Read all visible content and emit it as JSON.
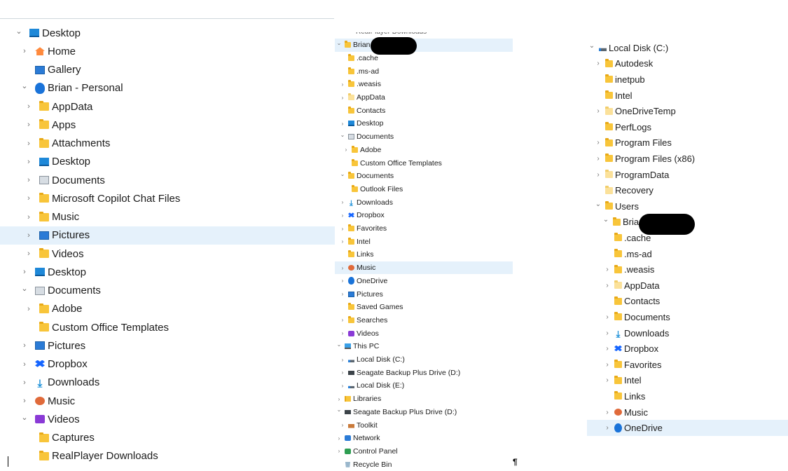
{
  "panel1": {
    "rows": [
      {
        "label": "Desktop",
        "indent": 0,
        "chev": "open",
        "icon": "monitor"
      },
      {
        "label": "Home",
        "indent": 1,
        "chev": "closed",
        "icon": "home"
      },
      {
        "label": "Gallery",
        "indent": 1,
        "chev": "none",
        "icon": "pic"
      },
      {
        "label": "Brian - Personal",
        "indent": 1,
        "chev": "open",
        "icon": "cloud"
      },
      {
        "label": "AppData",
        "indent": 2,
        "chev": "closed",
        "icon": "folder"
      },
      {
        "label": "Apps",
        "indent": 2,
        "chev": "closed",
        "icon": "folder"
      },
      {
        "label": "Attachments",
        "indent": 2,
        "chev": "closed",
        "icon": "folder"
      },
      {
        "label": "Desktop",
        "indent": 2,
        "chev": "closed",
        "icon": "monitor"
      },
      {
        "label": "Documents",
        "indent": 2,
        "chev": "closed",
        "icon": "doc"
      },
      {
        "label": "Microsoft Copilot Chat Files",
        "indent": 2,
        "chev": "closed",
        "icon": "folder"
      },
      {
        "label": "Music",
        "indent": 2,
        "chev": "closed",
        "icon": "folder"
      },
      {
        "label": "Pictures",
        "indent": 2,
        "chev": "closed",
        "icon": "pic",
        "selected": true
      },
      {
        "label": "Videos",
        "indent": 2,
        "chev": "closed",
        "icon": "folder"
      },
      {
        "label": "Desktop",
        "indent": 1,
        "chev": "closed",
        "icon": "monitor"
      },
      {
        "label": "Documents",
        "indent": 1,
        "chev": "open",
        "icon": "doc"
      },
      {
        "label": "Adobe",
        "indent": 2,
        "chev": "closed",
        "icon": "folder"
      },
      {
        "label": "Custom Office Templates",
        "indent": 2,
        "chev": "none",
        "icon": "folder"
      },
      {
        "label": "Pictures",
        "indent": 1,
        "chev": "closed",
        "icon": "pic"
      },
      {
        "label": "Dropbox",
        "indent": 1,
        "chev": "closed",
        "icon": "dropbox"
      },
      {
        "label": "Downloads",
        "indent": 1,
        "chev": "closed",
        "icon": "download"
      },
      {
        "label": "Music",
        "indent": 1,
        "chev": "closed",
        "icon": "music"
      },
      {
        "label": "Videos",
        "indent": 1,
        "chev": "open",
        "icon": "video"
      },
      {
        "label": "Captures",
        "indent": 2,
        "chev": "none",
        "icon": "folder"
      },
      {
        "label": "RealPlayer Downloads",
        "indent": 2,
        "chev": "none",
        "icon": "folder"
      }
    ]
  },
  "panel2": {
    "top_cut_label": "RealPlayer Downloads",
    "rows": [
      {
        "label": "Brian",
        "indent": 0,
        "chev": "open",
        "icon": "folder",
        "selected": true
      },
      {
        "label": ".cache",
        "indent": 1,
        "chev": "none",
        "icon": "folder"
      },
      {
        "label": ".ms-ad",
        "indent": 1,
        "chev": "none",
        "icon": "folder"
      },
      {
        "label": ".weasis",
        "indent": 1,
        "chev": "closed",
        "icon": "folder"
      },
      {
        "label": "AppData",
        "indent": 1,
        "chev": "closed",
        "icon": "folder pale"
      },
      {
        "label": "Contacts",
        "indent": 1,
        "chev": "none",
        "icon": "folder"
      },
      {
        "label": "Desktop",
        "indent": 1,
        "chev": "closed",
        "icon": "monitor"
      },
      {
        "label": "Documents",
        "indent": 1,
        "chev": "open",
        "icon": "doc"
      },
      {
        "label": "Adobe",
        "indent": 2,
        "chev": "closed",
        "icon": "folder"
      },
      {
        "label": "Custom Office Templates",
        "indent": 2,
        "chev": "none",
        "icon": "folder"
      },
      {
        "label": "Documents",
        "indent": 1,
        "chev": "open",
        "icon": "folder"
      },
      {
        "label": "Outlook Files",
        "indent": 2,
        "chev": "none",
        "icon": "folder"
      },
      {
        "label": "Downloads",
        "indent": 1,
        "chev": "closed",
        "icon": "download"
      },
      {
        "label": "Dropbox",
        "indent": 1,
        "chev": "closed",
        "icon": "dropbox"
      },
      {
        "label": "Favorites",
        "indent": 1,
        "chev": "closed",
        "icon": "folder"
      },
      {
        "label": "Intel",
        "indent": 1,
        "chev": "closed",
        "icon": "folder"
      },
      {
        "label": "Links",
        "indent": 1,
        "chev": "none",
        "icon": "folder"
      },
      {
        "label": "Music",
        "indent": 1,
        "chev": "closed",
        "icon": "music",
        "selected": true
      },
      {
        "label": "OneDrive",
        "indent": 1,
        "chev": "closed",
        "icon": "cloud"
      },
      {
        "label": "Pictures",
        "indent": 1,
        "chev": "closed",
        "icon": "pic"
      },
      {
        "label": "Saved Games",
        "indent": 1,
        "chev": "none",
        "icon": "folder"
      },
      {
        "label": "Searches",
        "indent": 1,
        "chev": "closed",
        "icon": "folder"
      },
      {
        "label": "Videos",
        "indent": 1,
        "chev": "closed",
        "icon": "video"
      },
      {
        "label": "This PC",
        "indent": 0,
        "chev": "open",
        "icon": "pc"
      },
      {
        "label": "Local Disk (C:)",
        "indent": 1,
        "chev": "closed",
        "icon": "disk"
      },
      {
        "label": "Seagate Backup Plus Drive (D:)",
        "indent": 1,
        "chev": "closed",
        "icon": "drive"
      },
      {
        "label": "Local Disk (E:)",
        "indent": 1,
        "chev": "closed",
        "icon": "disk"
      },
      {
        "label": "Libraries",
        "indent": 0,
        "chev": "closed",
        "icon": "lib"
      },
      {
        "label": "Seagate Backup Plus Drive (D:)",
        "indent": 0,
        "chev": "open",
        "icon": "drive"
      },
      {
        "label": "Toolkit",
        "indent": 1,
        "chev": "closed",
        "icon": "tool"
      },
      {
        "label": "Network",
        "indent": 0,
        "chev": "closed",
        "icon": "net"
      },
      {
        "label": "Control Panel",
        "indent": 0,
        "chev": "closed",
        "icon": "cp"
      },
      {
        "label": "Recycle Bin",
        "indent": 0,
        "chev": "none",
        "icon": "bin"
      }
    ]
  },
  "panel3": {
    "rows": [
      {
        "label": "Local Disk (C:)",
        "indent": 0,
        "chev": "open",
        "icon": "disk"
      },
      {
        "label": "Autodesk",
        "indent": 1,
        "chev": "closed",
        "icon": "folder"
      },
      {
        "label": "inetpub",
        "indent": 1,
        "chev": "none",
        "icon": "folder"
      },
      {
        "label": "Intel",
        "indent": 1,
        "chev": "none",
        "icon": "folder"
      },
      {
        "label": "OneDriveTemp",
        "indent": 1,
        "chev": "closed",
        "icon": "folder pale"
      },
      {
        "label": "PerfLogs",
        "indent": 1,
        "chev": "none",
        "icon": "folder"
      },
      {
        "label": "Program Files",
        "indent": 1,
        "chev": "closed",
        "icon": "folder"
      },
      {
        "label": "Program Files (x86)",
        "indent": 1,
        "chev": "closed",
        "icon": "folder"
      },
      {
        "label": "ProgramData",
        "indent": 1,
        "chev": "closed",
        "icon": "folder pale"
      },
      {
        "label": "Recovery",
        "indent": 1,
        "chev": "none",
        "icon": "folder pale"
      },
      {
        "label": "Users",
        "indent": 1,
        "chev": "open",
        "icon": "folder"
      },
      {
        "label": "Brian",
        "indent": 2,
        "chev": "open",
        "icon": "folder"
      },
      {
        "label": ".cache",
        "indent": 3,
        "chev": "none",
        "icon": "folder"
      },
      {
        "label": ".ms-ad",
        "indent": 3,
        "chev": "none",
        "icon": "folder"
      },
      {
        "label": ".weasis",
        "indent": 3,
        "chev": "closed",
        "icon": "folder"
      },
      {
        "label": "AppData",
        "indent": 3,
        "chev": "closed",
        "icon": "folder pale"
      },
      {
        "label": "Contacts",
        "indent": 3,
        "chev": "none",
        "icon": "folder"
      },
      {
        "label": "Documents",
        "indent": 3,
        "chev": "closed",
        "icon": "folder"
      },
      {
        "label": "Downloads",
        "indent": 3,
        "chev": "closed",
        "icon": "download"
      },
      {
        "label": "Dropbox",
        "indent": 3,
        "chev": "closed",
        "icon": "dropbox"
      },
      {
        "label": "Favorites",
        "indent": 3,
        "chev": "closed",
        "icon": "folder"
      },
      {
        "label": "Intel",
        "indent": 3,
        "chev": "closed",
        "icon": "folder"
      },
      {
        "label": "Links",
        "indent": 3,
        "chev": "none",
        "icon": "folder"
      },
      {
        "label": "Music",
        "indent": 3,
        "chev": "closed",
        "icon": "music"
      },
      {
        "label": "OneDrive",
        "indent": 3,
        "chev": "closed",
        "icon": "cloud",
        "selected": true
      }
    ]
  },
  "colors": {
    "selection": "#e5f1fb",
    "folder": "#f8c53a",
    "accent": "#1a73d9"
  }
}
